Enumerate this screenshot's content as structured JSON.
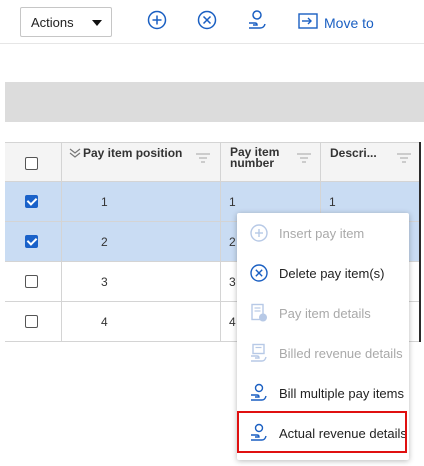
{
  "toolbar": {
    "actions_label": "Actions",
    "icons": [
      "plus-circle-icon",
      "x-circle-icon",
      "hand-coin-icon",
      "move-arrow-icon"
    ],
    "move_to_label": "Move to",
    "accent_color": "#1a5fc2"
  },
  "grid": {
    "columns": [
      "Pay item position",
      "Pay item number",
      "Descri..."
    ],
    "rows": [
      {
        "position": "1",
        "number": "1",
        "description": "1",
        "selected": true
      },
      {
        "position": "2",
        "number": "2",
        "description": "",
        "selected": true
      },
      {
        "position": "3",
        "number": "3",
        "description": "",
        "selected": false
      },
      {
        "position": "4",
        "number": "4",
        "description": "",
        "selected": false
      }
    ],
    "selected_row_color": "#c9dcf3"
  },
  "context_menu": {
    "items": [
      {
        "label": "Insert pay item",
        "icon": "plus-circle-icon",
        "disabled": true
      },
      {
        "label": "Delete pay item(s)",
        "icon": "x-circle-icon",
        "disabled": false
      },
      {
        "label": "Pay item details",
        "icon": "document-info-icon",
        "disabled": true
      },
      {
        "label": "Billed revenue details",
        "icon": "billed-revenue-icon",
        "disabled": true
      },
      {
        "label": "Bill multiple pay items",
        "icon": "hand-coin-icon",
        "disabled": false
      },
      {
        "label": "Actual revenue details",
        "icon": "hand-coin-icon",
        "disabled": false,
        "highlighted": true
      }
    ],
    "highlight_color": "#e01010"
  }
}
